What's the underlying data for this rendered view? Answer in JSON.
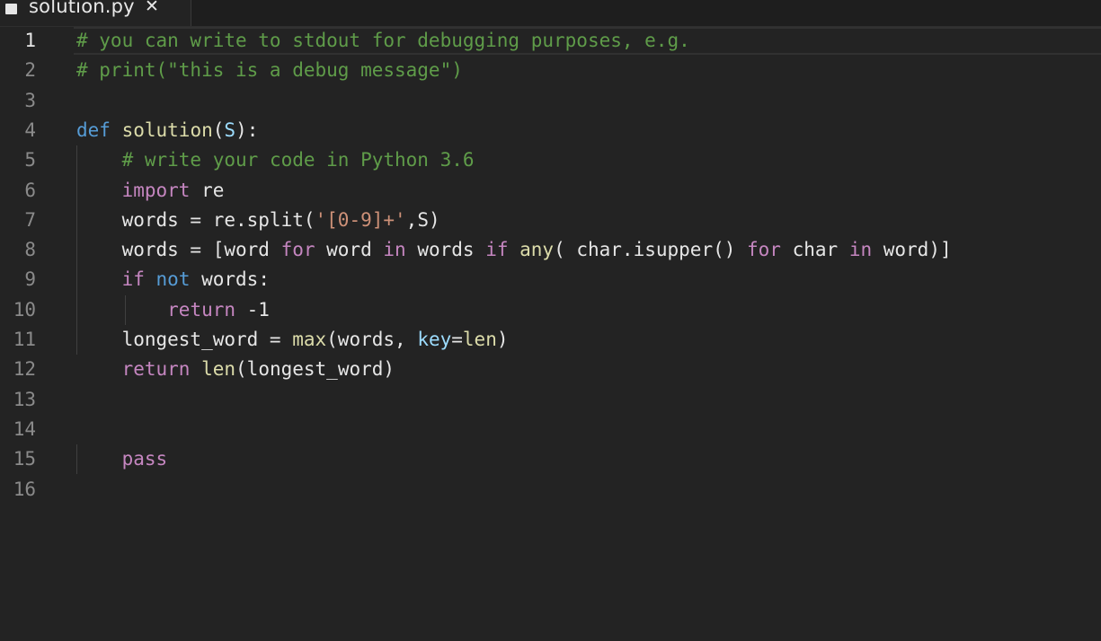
{
  "tab": {
    "title": "solution.py",
    "close_glyph": "✕",
    "icon": "file-icon"
  },
  "editor": {
    "language": "python",
    "active_line": 1,
    "lines": [
      {
        "number": "1",
        "tokens": [
          {
            "t": "# you can write to stdout for debugging purposes, e.g.",
            "c": "cm"
          }
        ]
      },
      {
        "number": "2",
        "tokens": [
          {
            "t": "# print(\"this is a debug message\")",
            "c": "cm"
          }
        ]
      },
      {
        "number": "3",
        "tokens": []
      },
      {
        "number": "4",
        "tokens": [
          {
            "t": "def",
            "c": "kw"
          },
          {
            "t": " "
          },
          {
            "t": "solution",
            "c": "fn"
          },
          {
            "t": "("
          },
          {
            "t": "S",
            "c": "par"
          },
          {
            "t": "):"
          }
        ]
      },
      {
        "number": "5",
        "tokens": [
          {
            "t": "    "
          },
          {
            "t": "# write your code in Python 3.6",
            "c": "cm"
          }
        ]
      },
      {
        "number": "6",
        "tokens": [
          {
            "t": "    "
          },
          {
            "t": "import",
            "c": "ctl"
          },
          {
            "t": " re"
          }
        ]
      },
      {
        "number": "7",
        "tokens": [
          {
            "t": "    words = re.split("
          },
          {
            "t": "'[0-9]+'",
            "c": "str"
          },
          {
            "t": ",S)"
          }
        ]
      },
      {
        "number": "8",
        "tokens": [
          {
            "t": "    words = [word "
          },
          {
            "t": "for",
            "c": "ctl"
          },
          {
            "t": " word "
          },
          {
            "t": "in",
            "c": "ctl"
          },
          {
            "t": " words "
          },
          {
            "t": "if",
            "c": "ctl"
          },
          {
            "t": " "
          },
          {
            "t": "any",
            "c": "fn"
          },
          {
            "t": "( char.isupper() "
          },
          {
            "t": "for",
            "c": "ctl"
          },
          {
            "t": " char "
          },
          {
            "t": "in",
            "c": "ctl"
          },
          {
            "t": " word)]"
          }
        ]
      },
      {
        "number": "9",
        "tokens": [
          {
            "t": "    "
          },
          {
            "t": "if",
            "c": "ctl"
          },
          {
            "t": " "
          },
          {
            "t": "not",
            "c": "kw"
          },
          {
            "t": " words:"
          }
        ]
      },
      {
        "number": "10",
        "tokens": [
          {
            "t": "        "
          },
          {
            "t": "return",
            "c": "ctl"
          },
          {
            "t": " -1"
          }
        ]
      },
      {
        "number": "11",
        "tokens": [
          {
            "t": "    longest_word = "
          },
          {
            "t": "max",
            "c": "fn"
          },
          {
            "t": "(words, "
          },
          {
            "t": "key",
            "c": "par"
          },
          {
            "t": "="
          },
          {
            "t": "len",
            "c": "fn"
          },
          {
            "t": ")"
          }
        ]
      },
      {
        "number": "12",
        "tokens": [
          {
            "t": "    "
          },
          {
            "t": "return",
            "c": "ctl"
          },
          {
            "t": " "
          },
          {
            "t": "len",
            "c": "fn"
          },
          {
            "t": "(longest_word)"
          }
        ]
      },
      {
        "number": "13",
        "tokens": []
      },
      {
        "number": "14",
        "tokens": []
      },
      {
        "number": "15",
        "tokens": [
          {
            "t": "    "
          },
          {
            "t": "pass",
            "c": "ctl"
          }
        ]
      },
      {
        "number": "16",
        "tokens": []
      }
    ]
  },
  "colors": {
    "background": "#232323",
    "comment": "#5f9c49",
    "keyword": "#569cd6",
    "control": "#c586c0",
    "function": "#dcdcaa",
    "parameter": "#9cdcfe",
    "string": "#ce9178",
    "line_number": "#8a8a8a"
  }
}
